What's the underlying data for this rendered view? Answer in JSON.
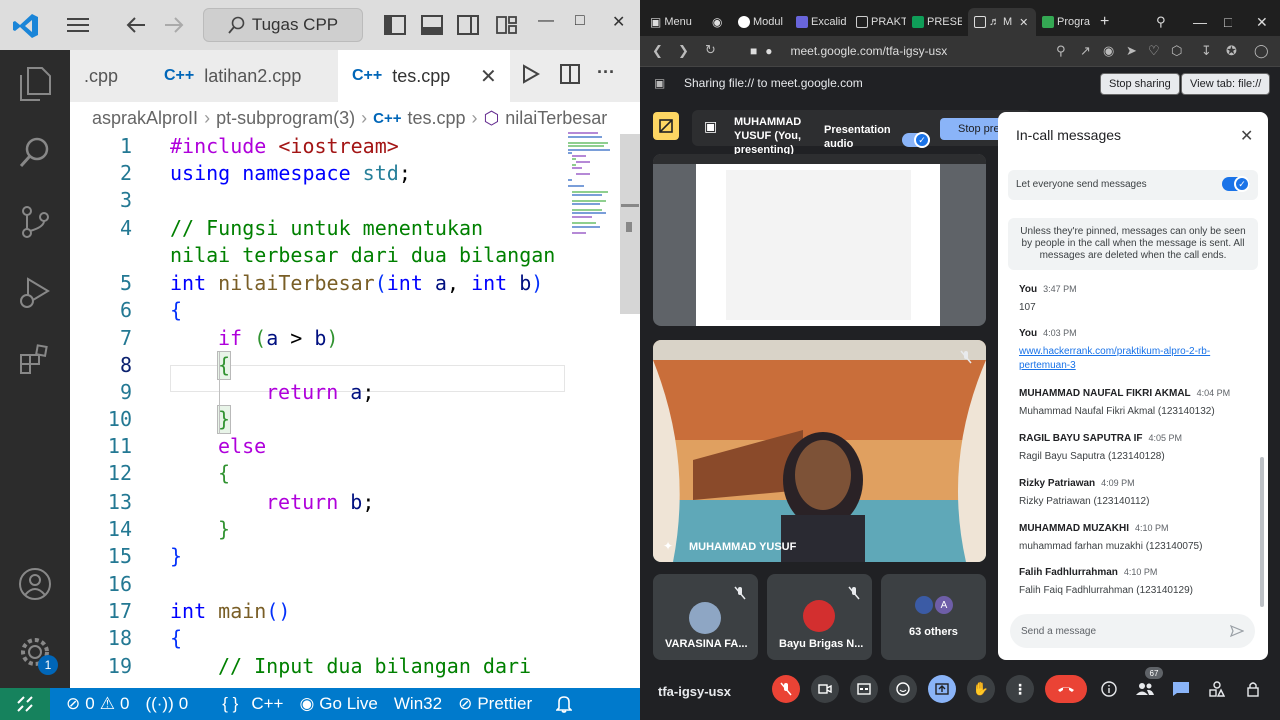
{
  "vscode": {
    "search_label": "Tugas CPP",
    "tabs": [
      {
        "label": ".cpp"
      },
      {
        "label": "latihan2.cpp"
      },
      {
        "label": "tes.cpp"
      }
    ],
    "breadcrumb": [
      "asprakAlproII",
      "pt-subprogram(3)",
      "tes.cpp",
      "nilaiTerbesar"
    ],
    "code": {
      "l1_a": "#include ",
      "l1_b": "<iostream>",
      "l2_a": "using",
      "l2_b": " namespace",
      "l2_c": " std",
      "l2_d": ";",
      "l4": "// Fungsi untuk menentukan",
      "l4b": "nilai terbesar dari dua bilangan",
      "l5_a": "int",
      "l5_b": " nilaiTerbesar",
      "l5_c": "(",
      "l5_d": "int",
      "l5_e": " a",
      "l5_f": ", ",
      "l5_g": "int",
      "l5_h": " b",
      "l5_i": ")",
      "l6": "{",
      "l7_a": "if",
      "l7_b": " (",
      "l7_c": "a",
      "l7_d": " > ",
      "l7_e": "b",
      "l7_f": ")",
      "l8": "{",
      "l9_a": "return",
      "l9_b": " a",
      "l9_c": ";",
      "l10": "}",
      "l11": "else",
      "l12": "{",
      "l13_a": "return",
      "l13_b": " b",
      "l13_c": ";",
      "l14": "}",
      "l15": "}",
      "l17_a": "int",
      "l17_b": " main",
      "l17_c": "()",
      "l18": "{",
      "l19": "// Input dua bilangan dari"
    },
    "line_numbers": [
      "1",
      "2",
      "3",
      "4",
      "5",
      "6",
      "7",
      "8",
      "9",
      "10",
      "11",
      "12",
      "13",
      "14",
      "15",
      "16",
      "17",
      "18",
      "19"
    ],
    "activity_badge": "1",
    "status": {
      "errors": "0",
      "warnings": "0",
      "ports": "0",
      "lang_braces": "{ }",
      "language": "C++",
      "golive": "Go Live",
      "platform": "Win32",
      "prettier": "Prettier"
    }
  },
  "chrome": {
    "tabs": [
      {
        "label": "Menu"
      },
      {
        "label": "Modul"
      },
      {
        "label": "Excalid"
      },
      {
        "label": "PRAKT"
      },
      {
        "label": "PRESE"
      },
      {
        "label": "M"
      },
      {
        "label": "Progra"
      }
    ],
    "url": "meet.google.com/tfa-igsy-usx",
    "share_text": "Sharing file:// to meet.google.com",
    "stop_sharing": "Stop sharing",
    "view_tab": "View tab: file://",
    "presenter_name": "MUHAMMAD YUSUF (You, presenting)",
    "presentation_audio": "Presentation audio",
    "stop_presenting": "Stop pre",
    "main_tile_name": "MUHAMMAD YUSUF",
    "participants": [
      {
        "name": "VARASINA FA..."
      },
      {
        "name": "Bayu Brigas N..."
      },
      {
        "name": "63 others"
      }
    ],
    "others_avatar_letter": "A",
    "meeting_code": "tfa-igsy-usx",
    "people_count": "67",
    "chat": {
      "title": "In-call messages",
      "toggle_label": "Let everyone send messages",
      "note": "Unless they're pinned, messages can only be seen by people in the call when the message is sent. All messages are deleted when the call ends.",
      "messages": [
        {
          "sender": "You",
          "time": "3:47 PM",
          "text": "107"
        },
        {
          "sender": "You",
          "time": "4:03 PM",
          "text": "www.hackerrank.com/praktikum-alpro-2-rb-pertemuan-3"
        },
        {
          "sender": "MUHAMMAD NAUFAL FIKRI AKMAL",
          "time": "4:04 PM",
          "text": "Muhammad Naufal Fikri Akmal (123140132)"
        },
        {
          "sender": "RAGIL BAYU SAPUTRA IF",
          "time": "4:05 PM",
          "text": "Ragil Bayu Saputra (123140128)"
        },
        {
          "sender": "Rizky Patriawan",
          "time": "4:09 PM",
          "text": "Rizky Patriawan (123140112)"
        },
        {
          "sender": "MUHAMMAD MUZAKHI",
          "time": "4:10 PM",
          "text": "muhammad farhan muzakhi (123140075)"
        },
        {
          "sender": "Falih Fadhlurrahman",
          "time": "4:10 PM",
          "text": "Falih Faiq Fadhlurrahman (123140129)"
        }
      ],
      "input_placeholder": "Send a message"
    }
  }
}
